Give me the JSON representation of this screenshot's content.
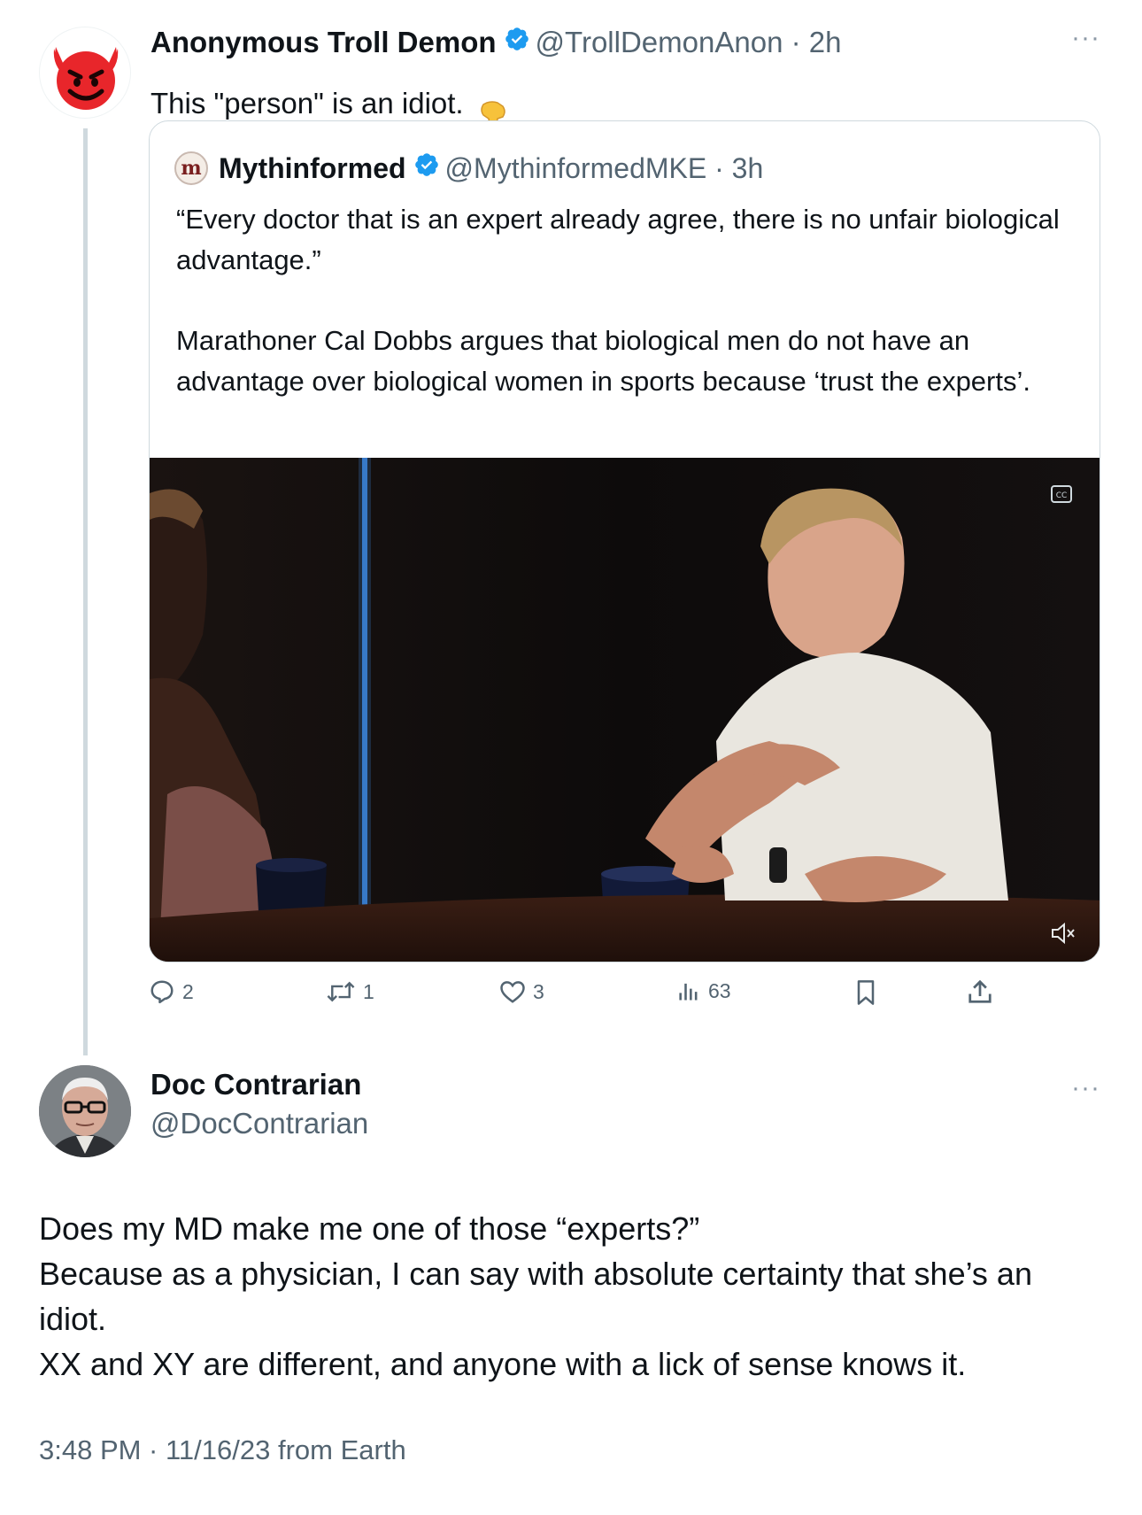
{
  "main_tweet": {
    "author": {
      "display_name": "Anonymous Troll Demon",
      "handle": "@TrollDemonAnon",
      "time": "2h",
      "avatar_icon": "smiling-devil-emoji",
      "verified": true
    },
    "text": "This \"person\" is an idiot.",
    "text_emoji": "pointing-down-emoji",
    "quoted_tweet": {
      "author": {
        "display_name": "Mythinformed",
        "handle": "@MythinformedMKE",
        "time": "3h",
        "avatar_letter": "m",
        "verified": true
      },
      "paragraph_1": "“Every doctor that is an expert already agree, there is no unfair biological advantage.”",
      "paragraph_2": "Marathoner Cal Dobbs argues that biological men do not have an advantage over biological women in sports because ‘trust the experts’.",
      "video": {
        "captions_icon": "captions-icon",
        "mute_icon": "speaker-muted-icon"
      }
    },
    "actions": {
      "replies": "2",
      "reposts": "1",
      "likes": "3",
      "views": "63"
    }
  },
  "reply": {
    "author": {
      "display_name": "Doc Contrarian",
      "handle": "@DocContrarian",
      "avatar_icon": "elderly-man-portrait"
    },
    "lines": [
      "Does my MD make me one of those “experts?”",
      "Because as a physician, I can say with absolute certainty that she’s an idiot.",
      "XX and XY are different, and anyone with a lick of sense knows it."
    ],
    "timestamp": "3:48 PM · 11/16/23 from Earth"
  },
  "colors": {
    "verified": "#1d9bf0",
    "secondary_text": "#536471",
    "border": "#cfd9de",
    "devil_red": "#e8262b"
  }
}
